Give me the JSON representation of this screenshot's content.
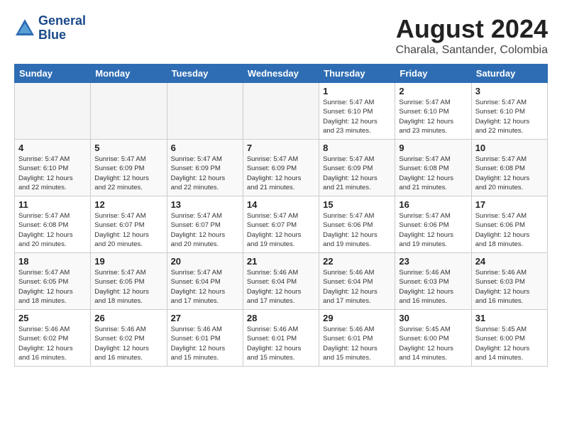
{
  "header": {
    "logo_line1": "General",
    "logo_line2": "Blue",
    "month_year": "August 2024",
    "location": "Charala, Santander, Colombia"
  },
  "days_of_week": [
    "Sunday",
    "Monday",
    "Tuesday",
    "Wednesday",
    "Thursday",
    "Friday",
    "Saturday"
  ],
  "weeks": [
    [
      {
        "num": "",
        "info": ""
      },
      {
        "num": "",
        "info": ""
      },
      {
        "num": "",
        "info": ""
      },
      {
        "num": "",
        "info": ""
      },
      {
        "num": "1",
        "info": "Sunrise: 5:47 AM\nSunset: 6:10 PM\nDaylight: 12 hours\nand 23 minutes."
      },
      {
        "num": "2",
        "info": "Sunrise: 5:47 AM\nSunset: 6:10 PM\nDaylight: 12 hours\nand 23 minutes."
      },
      {
        "num": "3",
        "info": "Sunrise: 5:47 AM\nSunset: 6:10 PM\nDaylight: 12 hours\nand 22 minutes."
      }
    ],
    [
      {
        "num": "4",
        "info": "Sunrise: 5:47 AM\nSunset: 6:10 PM\nDaylight: 12 hours\nand 22 minutes."
      },
      {
        "num": "5",
        "info": "Sunrise: 5:47 AM\nSunset: 6:09 PM\nDaylight: 12 hours\nand 22 minutes."
      },
      {
        "num": "6",
        "info": "Sunrise: 5:47 AM\nSunset: 6:09 PM\nDaylight: 12 hours\nand 22 minutes."
      },
      {
        "num": "7",
        "info": "Sunrise: 5:47 AM\nSunset: 6:09 PM\nDaylight: 12 hours\nand 21 minutes."
      },
      {
        "num": "8",
        "info": "Sunrise: 5:47 AM\nSunset: 6:09 PM\nDaylight: 12 hours\nand 21 minutes."
      },
      {
        "num": "9",
        "info": "Sunrise: 5:47 AM\nSunset: 6:08 PM\nDaylight: 12 hours\nand 21 minutes."
      },
      {
        "num": "10",
        "info": "Sunrise: 5:47 AM\nSunset: 6:08 PM\nDaylight: 12 hours\nand 20 minutes."
      }
    ],
    [
      {
        "num": "11",
        "info": "Sunrise: 5:47 AM\nSunset: 6:08 PM\nDaylight: 12 hours\nand 20 minutes."
      },
      {
        "num": "12",
        "info": "Sunrise: 5:47 AM\nSunset: 6:07 PM\nDaylight: 12 hours\nand 20 minutes."
      },
      {
        "num": "13",
        "info": "Sunrise: 5:47 AM\nSunset: 6:07 PM\nDaylight: 12 hours\nand 20 minutes."
      },
      {
        "num": "14",
        "info": "Sunrise: 5:47 AM\nSunset: 6:07 PM\nDaylight: 12 hours\nand 19 minutes."
      },
      {
        "num": "15",
        "info": "Sunrise: 5:47 AM\nSunset: 6:06 PM\nDaylight: 12 hours\nand 19 minutes."
      },
      {
        "num": "16",
        "info": "Sunrise: 5:47 AM\nSunset: 6:06 PM\nDaylight: 12 hours\nand 19 minutes."
      },
      {
        "num": "17",
        "info": "Sunrise: 5:47 AM\nSunset: 6:06 PM\nDaylight: 12 hours\nand 18 minutes."
      }
    ],
    [
      {
        "num": "18",
        "info": "Sunrise: 5:47 AM\nSunset: 6:05 PM\nDaylight: 12 hours\nand 18 minutes."
      },
      {
        "num": "19",
        "info": "Sunrise: 5:47 AM\nSunset: 6:05 PM\nDaylight: 12 hours\nand 18 minutes."
      },
      {
        "num": "20",
        "info": "Sunrise: 5:47 AM\nSunset: 6:04 PM\nDaylight: 12 hours\nand 17 minutes."
      },
      {
        "num": "21",
        "info": "Sunrise: 5:46 AM\nSunset: 6:04 PM\nDaylight: 12 hours\nand 17 minutes."
      },
      {
        "num": "22",
        "info": "Sunrise: 5:46 AM\nSunset: 6:04 PM\nDaylight: 12 hours\nand 17 minutes."
      },
      {
        "num": "23",
        "info": "Sunrise: 5:46 AM\nSunset: 6:03 PM\nDaylight: 12 hours\nand 16 minutes."
      },
      {
        "num": "24",
        "info": "Sunrise: 5:46 AM\nSunset: 6:03 PM\nDaylight: 12 hours\nand 16 minutes."
      }
    ],
    [
      {
        "num": "25",
        "info": "Sunrise: 5:46 AM\nSunset: 6:02 PM\nDaylight: 12 hours\nand 16 minutes."
      },
      {
        "num": "26",
        "info": "Sunrise: 5:46 AM\nSunset: 6:02 PM\nDaylight: 12 hours\nand 16 minutes."
      },
      {
        "num": "27",
        "info": "Sunrise: 5:46 AM\nSunset: 6:01 PM\nDaylight: 12 hours\nand 15 minutes."
      },
      {
        "num": "28",
        "info": "Sunrise: 5:46 AM\nSunset: 6:01 PM\nDaylight: 12 hours\nand 15 minutes."
      },
      {
        "num": "29",
        "info": "Sunrise: 5:46 AM\nSunset: 6:01 PM\nDaylight: 12 hours\nand 15 minutes."
      },
      {
        "num": "30",
        "info": "Sunrise: 5:45 AM\nSunset: 6:00 PM\nDaylight: 12 hours\nand 14 minutes."
      },
      {
        "num": "31",
        "info": "Sunrise: 5:45 AM\nSunset: 6:00 PM\nDaylight: 12 hours\nand 14 minutes."
      }
    ]
  ]
}
